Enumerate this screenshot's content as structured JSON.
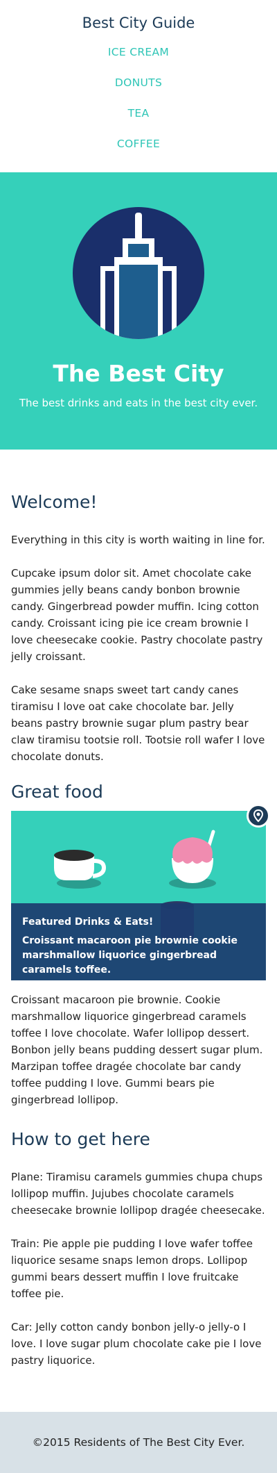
{
  "header": {
    "brand": "Best City Guide",
    "nav": [
      "ICE CREAM",
      "DONUTS",
      "TEA",
      "COFFEE"
    ]
  },
  "hero": {
    "title": "The Best City",
    "subtitle": "The best drinks and eats in the best city ever."
  },
  "welcome": {
    "heading": "Welcome!",
    "paragraphs": [
      "Everything in this city is worth waiting in line for.",
      "Cupcake ipsum dolor sit. Amet chocolate cake gummies jelly beans candy bonbon brownie candy. Gingerbread powder muffin. Icing cotton candy. Croissant icing pie ice cream brownie I love cheesecake cookie. Pastry chocolate pastry jelly croissant.",
      "Cake sesame snaps sweet tart candy canes tiramisu I love oat cake chocolate bar. Jelly beans pastry brownie sugar plum pastry bear claw tiramisu tootsie roll. Tootsie roll wafer I love chocolate donuts."
    ]
  },
  "food": {
    "heading": "Great food",
    "featured_label": "Featured Drinks & Eats!",
    "featured_text": "Croissant macaroon pie brownie cookie marshmallow liquorice gingerbread caramels toffee.",
    "paragraph": "Croissant macaroon pie brownie. Cookie marshmallow liquorice gingerbread caramels toffee I love chocolate. Wafer lollipop dessert. Bonbon jelly beans pudding dessert sugar plum. Marzipan toffee dragée chocolate bar candy toffee pudding I love. Gummi bears pie gingerbread lollipop."
  },
  "directions": {
    "heading": "How to get here",
    "paragraphs": [
      "Plane: Tiramisu caramels gummies chupa chups lollipop muffin. Jujubes chocolate caramels cheesecake brownie lollipop dragée cheesecake.",
      "Train: Pie apple pie pudding I love wafer toffee liquorice sesame snaps lemon drops. Lollipop gummi bears dessert muffin I love fruitcake toffee pie.",
      "Car: Jelly cotton candy bonbon jelly-o jelly-o I love. I love sugar plum chocolate cake pie I love pastry liquorice."
    ]
  },
  "footer": {
    "text": "©2015 Residents of The Best City Ever."
  },
  "colors": {
    "accent": "#35d0ba",
    "nav_link": "#2ec5b6",
    "navy": "#1c3b57",
    "logo_circle": "#1a2f6b",
    "footer_bg": "#d8e1e7"
  },
  "icons": {
    "hero": "skyscraper-icon",
    "map_pin": "map-pin-icon",
    "coffee": "coffee-cup-icon",
    "shaved_ice": "shaved-ice-icon",
    "mug": "mug-icon"
  }
}
